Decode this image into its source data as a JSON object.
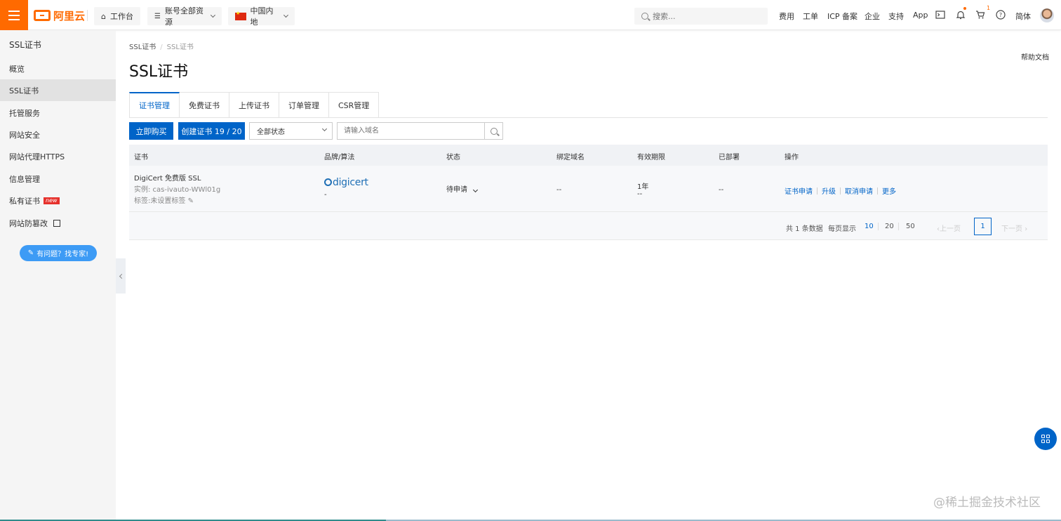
{
  "topbar": {
    "logo_text": "阿里云",
    "workbench": "工作台",
    "resources": "账号全部资源",
    "region": "中国内地",
    "search_placeholder": "搜索...",
    "nav": [
      "费用",
      "工单",
      "ICP 备案",
      "企业",
      "支持",
      "App"
    ],
    "cart_badge": "1",
    "language": "简体",
    "icons": [
      "menu-icon",
      "home-icon",
      "list-icon",
      "flag-icon",
      "terminal-icon",
      "bell-icon",
      "cart-icon",
      "help-icon"
    ],
    "accent_color": "#ff6a00"
  },
  "sidebar": {
    "title": "SSL证书",
    "items": [
      {
        "label": "概览"
      },
      {
        "label": "SSL证书",
        "active": true
      },
      {
        "label": "托管服务"
      },
      {
        "label": "网站安全"
      },
      {
        "label": "网站代理HTTPS"
      },
      {
        "label": "信息管理"
      },
      {
        "label": "私有证书",
        "tag": "new"
      },
      {
        "label": "网站防篡改"
      }
    ],
    "help_button": "有问题？找专家!"
  },
  "breadcrumb": [
    "SSL证书",
    "/",
    "SSL证书"
  ],
  "help_doc": "帮助文档",
  "page_title": "SSL证书",
  "tabs": [
    "证书管理",
    "免费证书",
    "上传证书",
    "订单管理",
    "CSR管理"
  ],
  "toolbar": {
    "buy_label": "立即购买",
    "create_label": "创建证书 19 / 20",
    "status_select": "全部状态",
    "domain_placeholder": "请输入域名"
  },
  "table": {
    "headers": [
      "证书",
      "品牌/算法",
      "状态",
      "绑定域名",
      "有效期限",
      "已部署",
      "操作"
    ],
    "rows": [
      {
        "name": "DigiCert 免费版 SSL",
        "instance": "实例: cas-ivauto-WWl01g",
        "tag": "标签:未设置标签",
        "brand": "digicert",
        "algorithm": "-",
        "status": "待申请",
        "domain": "--",
        "validity": "1年",
        "validity_sub": "--",
        "deployed": "--",
        "actions": [
          "证书申请",
          "升级",
          "取消申请",
          "更多"
        ]
      }
    ]
  },
  "pagination": {
    "total": "共 1 条数据",
    "per_page_label": "每页显示",
    "sizes": [
      "10",
      "20",
      "50"
    ],
    "prev": "上一页",
    "current": "1",
    "next": "下一页"
  },
  "watermark": "@稀土掘金技术社区",
  "primary_color": "#0064c8"
}
